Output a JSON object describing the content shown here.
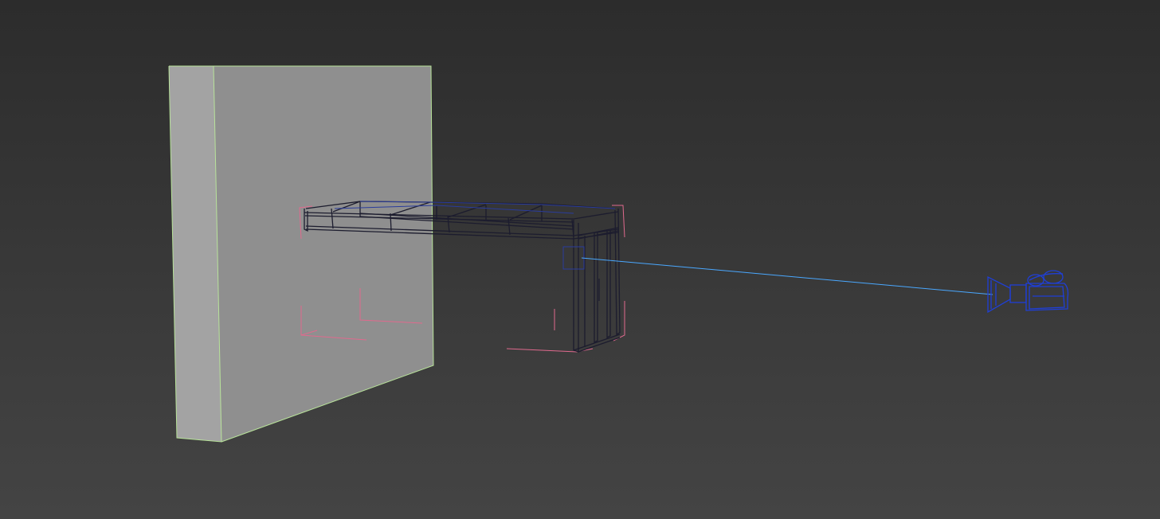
{
  "viewport": {
    "background_top": "#2c2c2c",
    "background_bottom": "#444444"
  },
  "objects": {
    "wall": {
      "front_color": "#8f8f8f",
      "side_color": "#a3a3a3",
      "edge_color": "#b8e39a"
    },
    "frame": {
      "wire_color": "#1c1c2e",
      "accent_wire_color": "#2a3c9c",
      "bbox_bracket_color": "#e06a8e"
    },
    "camera": {
      "icon": "camera-icon",
      "color": "#1f3fd6",
      "target_line_color": "#4aa8ff"
    }
  }
}
